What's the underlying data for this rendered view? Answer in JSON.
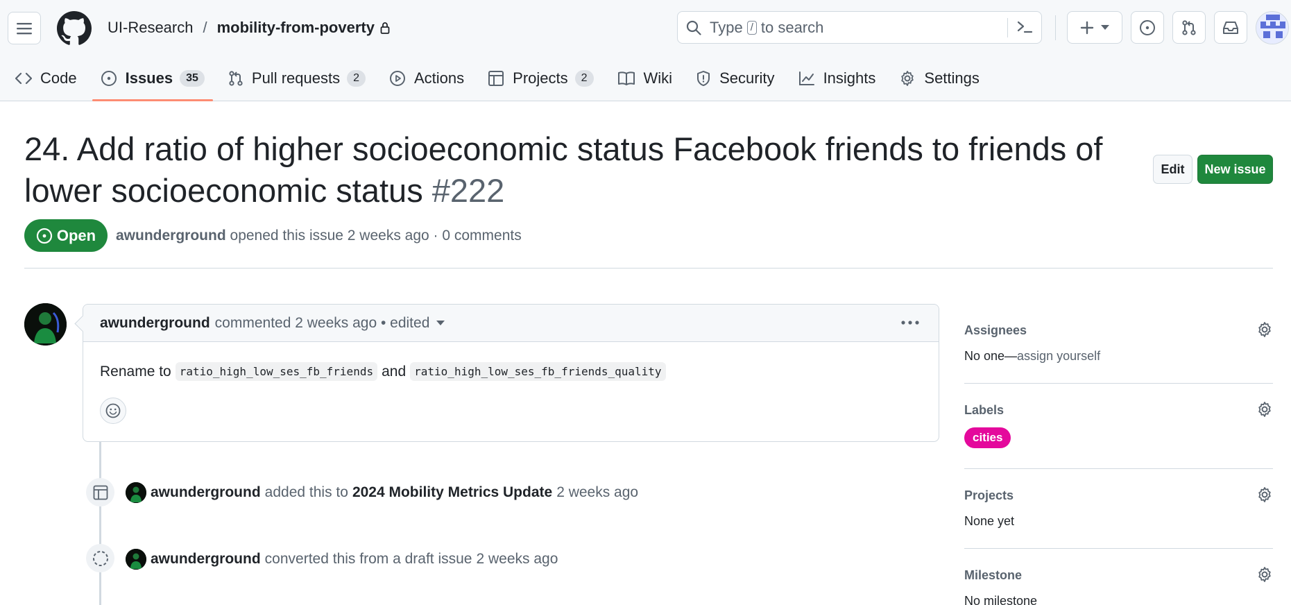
{
  "header": {
    "owner": "UI-Research",
    "separator": "/",
    "repo": "mobility-from-poverty",
    "search": {
      "prefix": "Type",
      "key": "/",
      "suffix": "to search"
    }
  },
  "tabs": [
    {
      "label": "Code"
    },
    {
      "label": "Issues",
      "count": "35"
    },
    {
      "label": "Pull requests",
      "count": "2"
    },
    {
      "label": "Actions"
    },
    {
      "label": "Projects",
      "count": "2"
    },
    {
      "label": "Wiki"
    },
    {
      "label": "Security"
    },
    {
      "label": "Insights"
    },
    {
      "label": "Settings"
    }
  ],
  "issue": {
    "title": "24. Add ratio of higher socioeconomic status Facebook friends to friends of lower socioeconomic status",
    "number": "#222",
    "edit_label": "Edit",
    "new_issue_label": "New issue",
    "state": "Open",
    "author": "awunderground",
    "opened_text": "opened this issue 2 weeks ago · 0 comments"
  },
  "comment": {
    "author": "awunderground",
    "meta": "commented 2 weeks ago • edited",
    "body_prefix": "Rename to",
    "code1": "ratio_high_low_ses_fb_friends",
    "joiner": "and",
    "code2": "ratio_high_low_ses_fb_friends_quality"
  },
  "timeline": [
    {
      "author": "awunderground",
      "action": "added this to",
      "target": "2024 Mobility Metrics Update",
      "time": "2 weeks ago"
    },
    {
      "author": "awunderground",
      "action": "converted this from a draft issue",
      "time": "2 weeks ago"
    }
  ],
  "sidebar": {
    "assignees": {
      "heading": "Assignees",
      "value": "No one—",
      "link": "assign yourself"
    },
    "labels": {
      "heading": "Labels",
      "items": [
        {
          "name": "cities",
          "color": "#e4099c"
        }
      ]
    },
    "projects": {
      "heading": "Projects",
      "value": "None yet"
    },
    "milestone": {
      "heading": "Milestone",
      "value": "No milestone"
    }
  },
  "colors": {
    "accent": "#1f883d",
    "tab_underline": "#fd8c73",
    "label_cities": "#e4099c"
  }
}
